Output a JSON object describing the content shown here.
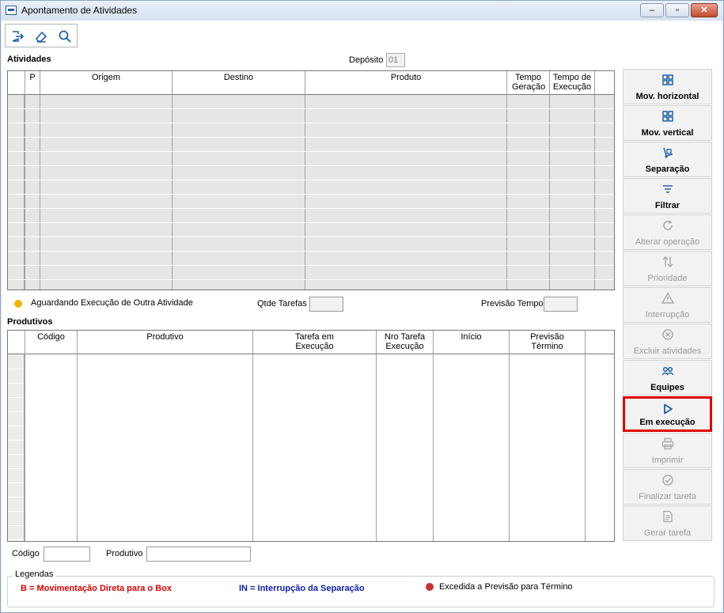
{
  "window": {
    "title": "Apontamento de Atividades",
    "minimize": "–",
    "maximize": "▫",
    "close": "✕"
  },
  "toolbar": {
    "exit_icon": "exit-icon",
    "clear_icon": "eraser-icon",
    "search_icon": "search-icon"
  },
  "atividades": {
    "label": "Atividades",
    "deposito_label": "Depósito",
    "deposito_value": "01",
    "columns": [
      "P",
      "Origem",
      "Destino",
      "Produto",
      "Tempo Geração",
      "Tempo de Execução"
    ],
    "row_count": 13
  },
  "status": {
    "legend_text": "Aguardando Execução de Outra Atividade",
    "legend_color": "#f0b400",
    "qtde_label": "Qtde Tarefas",
    "qtde_value": "",
    "previsao_label": "Previsão Tempo",
    "previsao_value": ""
  },
  "produtivos": {
    "label": "Produtivos",
    "columns": [
      "Código",
      "Produtivo",
      "Tarefa em Execução",
      "Nro Tarefa Execução",
      "Início",
      "Previsão Término"
    ]
  },
  "filters": {
    "codigo_label": "Código",
    "codigo_value": "",
    "produtivo_label": "Produtivo",
    "produtivo_value": ""
  },
  "legend": {
    "title": "Legendas",
    "b_text": "B = Movimentação Direta para o Box",
    "b_color": "#e00000",
    "in_text": "IN = Interrupção da Separação",
    "in_color": "#1020b0",
    "exceeded_text": "Excedida a Previsão para Término",
    "exceeded_color": "#c83232"
  },
  "sidebar": {
    "buttons": [
      {
        "label": "Mov. horizontal",
        "icon": "grid-move-icon",
        "enabled": true
      },
      {
        "label": "Mov. vertical",
        "icon": "grid-move-icon",
        "enabled": true
      },
      {
        "label": "Separação",
        "icon": "hand-truck-icon",
        "enabled": true
      },
      {
        "label": "Filtrar",
        "icon": "filter-icon",
        "enabled": true
      },
      {
        "label": "Alterar operação",
        "icon": "refresh-icon",
        "enabled": false
      },
      {
        "label": "Prioridade",
        "icon": "sort-arrows-icon",
        "enabled": false
      },
      {
        "label": "Interrupção",
        "icon": "warning-icon",
        "enabled": false
      },
      {
        "label": "Excluir atividades",
        "icon": "close-circle-icon",
        "enabled": false
      },
      {
        "label": "Equipes",
        "icon": "team-icon",
        "enabled": true
      },
      {
        "label": "Em execução",
        "icon": "play-icon",
        "enabled": true,
        "highlighted": true
      },
      {
        "label": "Imprimir",
        "icon": "printer-icon",
        "enabled": false
      },
      {
        "label": "Finalizar tarefa",
        "icon": "check-circle-icon",
        "enabled": false
      },
      {
        "label": "Gerar tarefa",
        "icon": "document-icon",
        "enabled": false
      }
    ]
  },
  "colors": {
    "accent": "#1f5fa8",
    "highlight": "#e00000",
    "grid_fill": "#e6e6e6"
  }
}
